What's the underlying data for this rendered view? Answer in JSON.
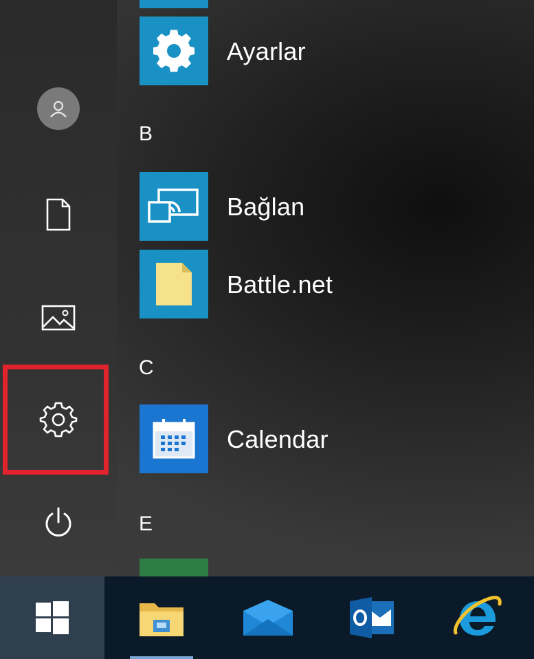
{
  "start_menu": {
    "apps": [
      {
        "label": "Ayarlar",
        "icon": "settings-gear-icon",
        "tile_color": "#1a91c4"
      },
      {
        "label": "Bağlan",
        "icon": "connect-cast-icon",
        "tile_color": "#1a91c4"
      },
      {
        "label": "Battle.net",
        "icon": "battlenet-file-icon",
        "tile_color": "#1a91c4"
      },
      {
        "label": "Calendar",
        "icon": "calendar-icon",
        "tile_color": "#1b76d1"
      }
    ],
    "groups": [
      "B",
      "C",
      "E"
    ],
    "rail": [
      "user-avatar-icon",
      "documents-icon",
      "pictures-icon",
      "settings-icon",
      "power-icon"
    ]
  },
  "taskbar": {
    "items": [
      "start-windows-icon",
      "file-explorer-icon",
      "mail-icon",
      "outlook-icon",
      "internet-explorer-icon"
    ]
  },
  "colors": {
    "highlight": "#e0232d",
    "tile_blue": "#1a91c4",
    "taskbar_bg": "#0b1a28"
  }
}
